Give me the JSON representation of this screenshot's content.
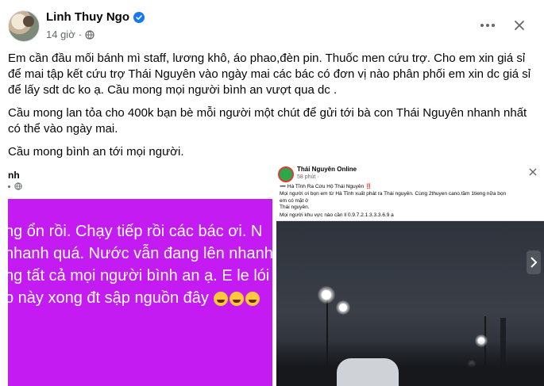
{
  "post": {
    "author": "Linh Thuy Ngo",
    "time": "14 giờ",
    "separator": "·",
    "paragraphs": [
      "Em cần đầu mối bánh mì staff, lương khô, áo phao,đèn pin. Thuốc men cứu trợ. Cho em xin giá sỉ để mai tập kết cứu trợ  Thái Nguyên vào ngày mai các bác có đơn vị nào phân phối em xin dc giá sỉ để lấy sdt dc ko ạ. Cầu mong mọi người bình an vượt qua dc .",
      "Cầu mong lan tỏa cho 400k bạn bè mỗi người một chút để gửi tới bà con Thái Nguyên nhanh nhất có thể vào ngày mai.",
      "Cầu mong bình an tới mọi người."
    ]
  },
  "images": {
    "left": {
      "name_fragment": "nh",
      "story_lines": [
        "ng ổn rồi. Chạy tiếp rồi các bác ơi. N",
        "nhanh quá. Nước vẫn đang lên nhanh",
        "ng tất cả mọi người bình an ạ. E le lói",
        "p này xong đt sập nguồn đây"
      ],
      "emojis": [
        "crying-face",
        "crying-face",
        "crying-face"
      ],
      "background": "#c31bf2"
    },
    "right": {
      "page_name": "Thái Nguyên Online",
      "page_time": "58 phút · ",
      "lines": [
        "➖ Hà Tĩnh Ra Cứu Hộ Thái Nguyên ‼️",
        "Mọi người ơi bọn em từ Hà Tĩnh xuất phát ra Thái nguyên. Cùng 2thuyen cano.tầm 1tieng nữa bọn",
        "em có mặt ở",
        "Thái nguyên.",
        "Mọi người khu vực nào cần ll 0.9.7.2.1.3.3.3.6.9  ạ"
      ]
    }
  },
  "colors": {
    "accent": "#1877f2",
    "muted": "#65676b",
    "text": "#050505"
  }
}
